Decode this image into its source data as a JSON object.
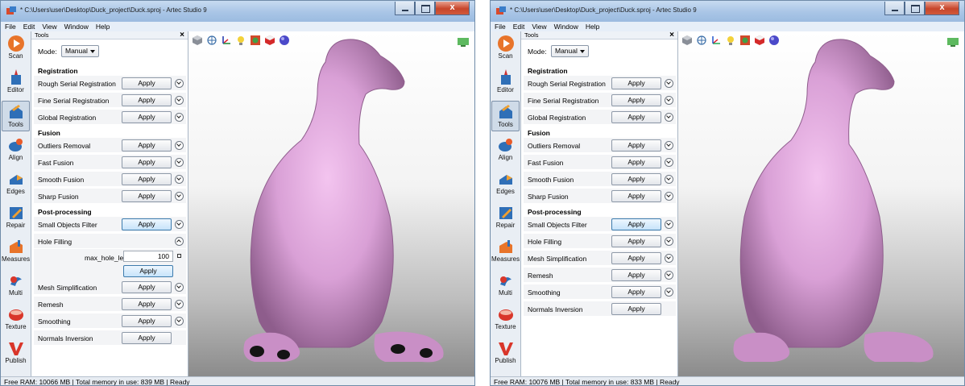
{
  "windows": [
    {
      "title": "* C:\\Users\\user\\Desktop\\Duck_project\\Duck.sproj - Artec Studio 9",
      "menu": [
        "File",
        "Edit",
        "View",
        "Window",
        "Help"
      ],
      "sidebar": [
        "Scan",
        "Editor",
        "Tools",
        "Align",
        "Edges",
        "Repair",
        "Measures",
        "Multi",
        "Texture",
        "Publish"
      ],
      "active_tool": "Tools",
      "panel": {
        "title": "Tools",
        "close": "×",
        "mode_label": "Mode:",
        "mode_value": "Manual",
        "sections": {
          "registration": "Registration",
          "fusion": "Fusion",
          "post": "Post-processing"
        },
        "rows": {
          "rough": "Rough Serial Registration",
          "fine": "Fine Serial Registration",
          "global": "Global Registration",
          "outliers": "Outliers Removal",
          "fast": "Fast Fusion",
          "smooth_fusion": "Smooth Fusion",
          "sharp": "Sharp Fusion",
          "small": "Small Objects Filter",
          "hole": "Hole Filling",
          "mesh": "Mesh Simplification",
          "remesh": "Remesh",
          "smoothing": "Smoothing",
          "normals": "Normals Inversion"
        },
        "apply_label": "Apply",
        "param_name": "max_hole_len",
        "param_value": "100"
      },
      "status": "Free RAM: 10066 MB  |  Total memory in use: 839 MB  |   Ready",
      "duck_color": "#d9a0d6"
    },
    {
      "title": "* C:\\Users\\user\\Desktop\\Duck_project\\Duck.sproj - Artec Studio 9",
      "menu": [
        "File",
        "Edit",
        "View",
        "Window",
        "Help"
      ],
      "sidebar": [
        "Scan",
        "Editor",
        "Tools",
        "Align",
        "Edges",
        "Repair",
        "Measures",
        "Multi",
        "Texture",
        "Publish"
      ],
      "active_tool": "Tools",
      "panel": {
        "title": "Tools",
        "close": "×",
        "mode_label": "Mode:",
        "mode_value": "Manual",
        "sections": {
          "registration": "Registration",
          "fusion": "Fusion",
          "post": "Post-processing"
        },
        "rows": {
          "rough": "Rough Serial Registration",
          "fine": "Fine Serial Registration",
          "global": "Global Registration",
          "outliers": "Outliers Removal",
          "fast": "Fast Fusion",
          "smooth_fusion": "Smooth Fusion",
          "sharp": "Sharp Fusion",
          "small": "Small Objects Filter",
          "hole": "Hole Filling",
          "mesh": "Mesh Simplification",
          "remesh": "Remesh",
          "smoothing": "Smoothing",
          "normals": "Normals Inversion"
        },
        "apply_label": "Apply"
      },
      "status": "Free RAM: 10076 MB  |  Total memory in use: 833 MB  |   Ready",
      "duck_color": "#d9a0d6"
    }
  ],
  "viewport_tools": [
    "view-cube-icon",
    "wireframe-icon",
    "axes-icon",
    "light-icon",
    "texture-icon",
    "box-icon",
    "sphere-icon",
    "moon-icon"
  ]
}
